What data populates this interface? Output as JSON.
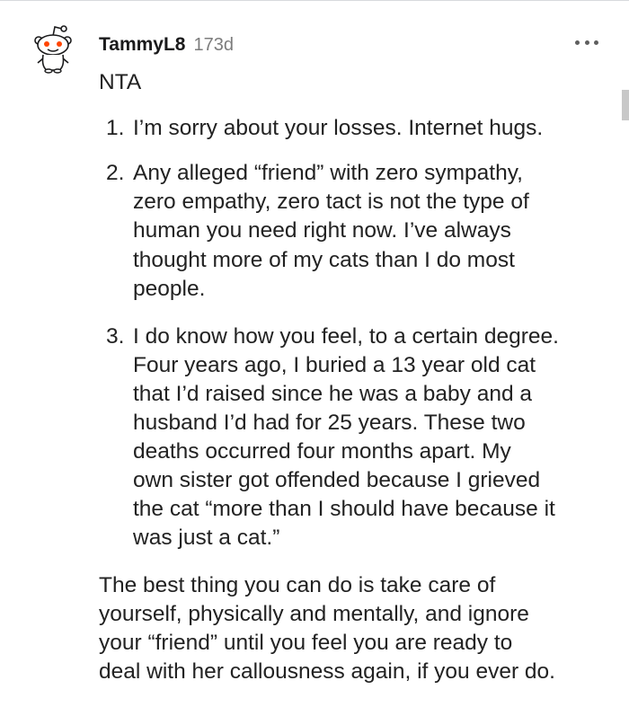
{
  "comment": {
    "username": "TammyL8",
    "timestamp": "173d",
    "verdict": "NTA",
    "list_items": [
      {
        "number": "1.",
        "lines": [
          "I’m sorry about your losses. Internet hugs."
        ]
      },
      {
        "number": "2.",
        "lines": [
          "Any alleged “friend” with zero sympathy,",
          "zero empathy, zero tact is not the type of",
          "human you need right now. I’ve always",
          "thought more of my cats than I do most",
          "people."
        ]
      },
      {
        "number": "3.",
        "lines": [
          "I do know how you feel, to a certain degree.",
          "Four years ago, I buried a 13 year old cat",
          "that I’d raised since he was a baby and a",
          "husband I’d had for 25 years. These two",
          "deaths occurred four months apart. My",
          "own sister got offended because I grieved",
          "the cat “more than I should have because it",
          "was just a cat.”"
        ]
      }
    ],
    "closing_lines": [
      "The best thing you can do is take care of",
      "yourself, physically and mentally, and ignore",
      "your “friend” until you feel you are ready to",
      "deal with her callousness again, if you ever do."
    ]
  },
  "icons": {
    "avatar": "reddit-snoo-icon",
    "more": "more-options-icon"
  },
  "colors": {
    "username": "#1a1a1b",
    "timestamp": "#7c7c7c",
    "body_text": "#222222",
    "snoo_eye": "#ff4500"
  }
}
